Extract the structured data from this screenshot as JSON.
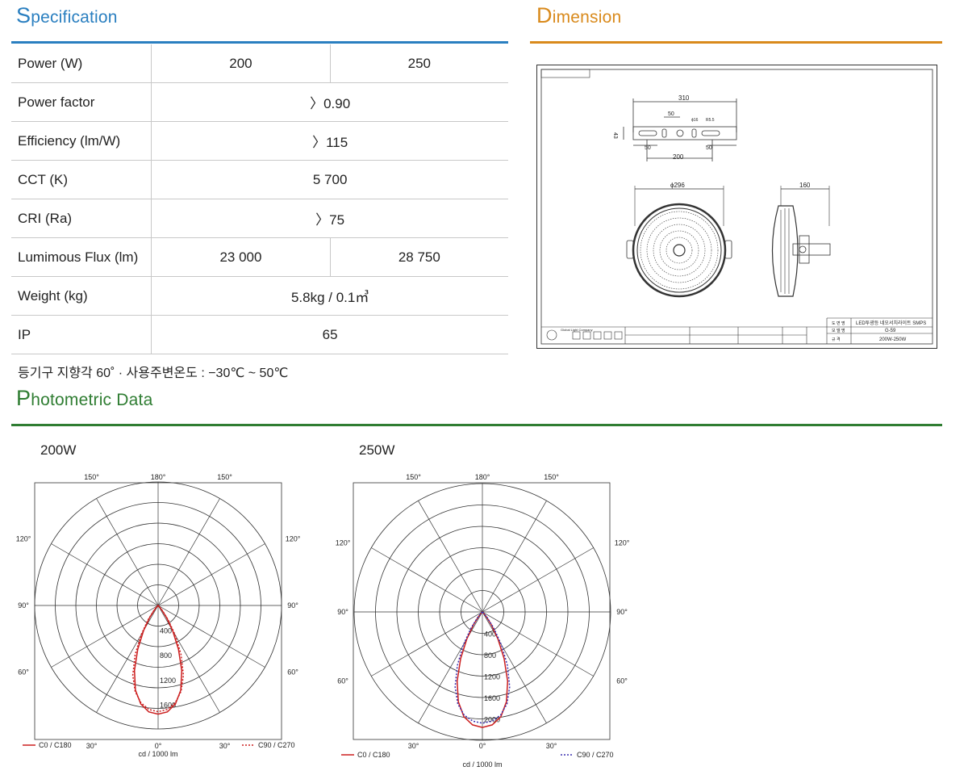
{
  "spec": {
    "title_cap": "S",
    "title_rest": "pecification",
    "color": "#2a7fc0",
    "rows": [
      {
        "label": "Power (W)",
        "values": [
          "200",
          "250"
        ]
      },
      {
        "label": "Power factor",
        "values": [
          "〉0.90"
        ]
      },
      {
        "label": "Efficiency (lm/W)",
        "values": [
          "〉115"
        ]
      },
      {
        "label": "CCT (K)",
        "values": [
          "5 700"
        ]
      },
      {
        "label": "CRI (Ra)",
        "values": [
          "〉75"
        ]
      },
      {
        "label": "Lumimous Flux (lm)",
        "values": [
          "23 000",
          "28 750"
        ]
      },
      {
        "label": "Weight (kg)",
        "values": [
          "5.8kg / 0.1㎥"
        ]
      },
      {
        "label": "IP",
        "values": [
          "65"
        ]
      }
    ],
    "note": "등기구 지향각 60˚ · 사용주변온도 : −30℃ ~ 50℃"
  },
  "dimension": {
    "title_cap": "D",
    "title_rest": "imension",
    "color": "#d98a1c",
    "labels": {
      "width_310": "310",
      "d50_top": "50",
      "hole": "ϕ16",
      "radius": "R5.5",
      "h43": "43",
      "d50_left": "50",
      "d50_right": "50",
      "d200": "200",
      "dia296": "ϕ296",
      "d160": "160"
    },
    "title_block": {
      "product_label": "도 면 명",
      "product_name": "LED투광등 네오서치라이트 SMPS",
      "model_label": "모 델 명",
      "model": "G-59",
      "spec_label": "규 격",
      "spec": "200W-250W",
      "company": "Global Light Company"
    }
  },
  "photometric": {
    "title_cap": "P",
    "title_rest": "hotometric Data",
    "color": "#2f7d32"
  },
  "chart_data": [
    {
      "type": "polar",
      "title": "200W",
      "angle_labels": [
        "150°",
        "180°",
        "150°",
        "120°",
        "120°",
        "90°",
        "90°",
        "60°",
        "60°",
        "30°",
        "0°",
        "30°"
      ],
      "radial_ticks": [
        400,
        800,
        1200,
        1600
      ],
      "rmax": 2000,
      "unit_label": "cd / 1000 lm",
      "series": [
        {
          "name": "C0 / C180",
          "color": "#cc1f1f",
          "style": "solid",
          "points": [
            [
              0,
              1760
            ],
            [
              5,
              1730
            ],
            [
              10,
              1620
            ],
            [
              15,
              1420
            ],
            [
              20,
              1120
            ],
            [
              25,
              780
            ],
            [
              30,
              470
            ],
            [
              35,
              240
            ],
            [
              40,
              90
            ],
            [
              45,
              20
            ]
          ]
        },
        {
          "name": "C90 / C270",
          "color": "#cc1f1f",
          "style": "dotted",
          "points": [
            [
              0,
              1720
            ],
            [
              5,
              1690
            ],
            [
              10,
              1600
            ],
            [
              15,
              1440
            ],
            [
              20,
              1200
            ],
            [
              25,
              880
            ],
            [
              30,
              560
            ],
            [
              35,
              290
            ],
            [
              40,
              110
            ],
            [
              45,
              25
            ]
          ]
        }
      ]
    },
    {
      "type": "polar",
      "title": "250W",
      "angle_labels": [
        "150°",
        "180°",
        "150°",
        "120°",
        "120°",
        "90°",
        "90°",
        "60°",
        "60°",
        "30°",
        "0°",
        "30°"
      ],
      "radial_ticks": [
        400,
        800,
        1200,
        1600,
        2000
      ],
      "rmax": 2400,
      "unit_label": "cd / 1000 lm",
      "series": [
        {
          "name": "C0 / C180",
          "color": "#cc1f1f",
          "style": "solid",
          "points": [
            [
              0,
              2160
            ],
            [
              5,
              2120
            ],
            [
              10,
              1990
            ],
            [
              15,
              1740
            ],
            [
              20,
              1380
            ],
            [
              25,
              960
            ],
            [
              30,
              580
            ],
            [
              35,
              290
            ],
            [
              40,
              110
            ],
            [
              45,
              25
            ]
          ]
        },
        {
          "name": "C90 / C270",
          "color": "#3a2fb0",
          "style": "dotted",
          "points": [
            [
              0,
              2080
            ],
            [
              5,
              2050
            ],
            [
              10,
              1960
            ],
            [
              15,
              1780
            ],
            [
              20,
              1490
            ],
            [
              25,
              1110
            ],
            [
              30,
              720
            ],
            [
              35,
              380
            ],
            [
              40,
              150
            ],
            [
              45,
              35
            ]
          ]
        }
      ]
    }
  ]
}
